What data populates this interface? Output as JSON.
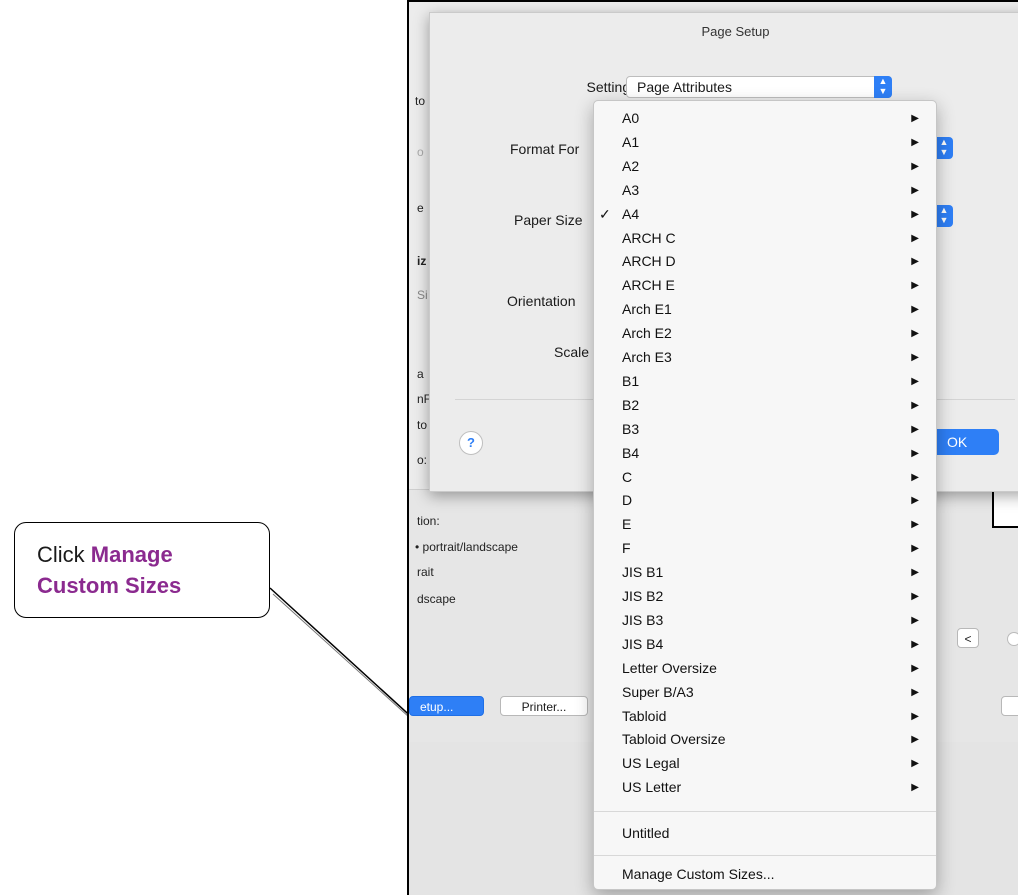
{
  "callout": {
    "prefix": "Click",
    "highlight_line1": "Manage",
    "highlight_line2": "Custom Sizes",
    "highlight_color": "#8b2a8f"
  },
  "background": {
    "sidebar_fragments": [
      "to",
      "o",
      "e",
      "e",
      "iz",
      "Si",
      "a",
      "nF",
      "to",
      "o:"
    ],
    "orientation_section_label": "tion:",
    "auto_option": "portrait/landscape",
    "portrait_option": "rait",
    "landscape_option": "dscape",
    "page_setup_button": "etup...",
    "printer_button": "Printer...",
    "nav_prev_button": "<"
  },
  "page_setup": {
    "title": "Page Setup",
    "settings_label": "Settings:",
    "settings_value": "Page Attributes",
    "format_for_label": "Format For",
    "paper_size_label": "Paper Size",
    "orientation_label": "Orientation",
    "scale_label": "Scale",
    "help_label": "?",
    "ok_label": "OK",
    "accent_color": "#2e7ff6"
  },
  "paper_menu": {
    "selected": "A4",
    "checkmark": "✓",
    "submenu_arrow": "▶",
    "items": [
      "A0",
      "A1",
      "A2",
      "A3",
      "A4",
      "ARCH C",
      "ARCH D",
      "ARCH E",
      "Arch E1",
      "Arch E2",
      "Arch E3",
      "B1",
      "B2",
      "B3",
      "B4",
      "C",
      "D",
      "E",
      "F",
      "JIS B1",
      "JIS B2",
      "JIS B3",
      "JIS B4",
      "Letter Oversize",
      "Super B/A3",
      "Tabloid",
      "Tabloid Oversize",
      "US Legal",
      "US Letter"
    ],
    "untitled_label": "Untitled",
    "manage_label": "Manage Custom Sizes..."
  }
}
